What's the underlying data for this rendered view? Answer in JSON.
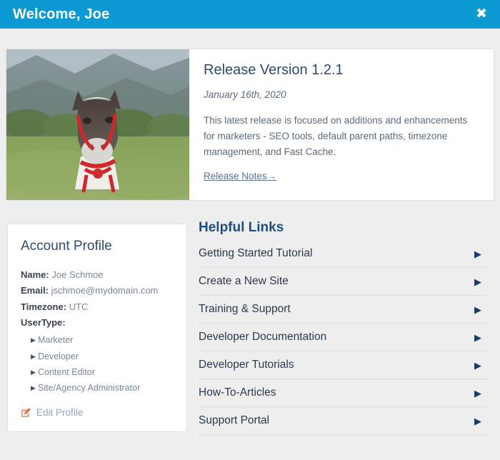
{
  "header": {
    "title": "Welcome, Joe",
    "close_label": "✖"
  },
  "release": {
    "title": "Release Version 1.2.1",
    "date": "January 16th, 2020",
    "description": "This latest release is focused on additions and enhancements for marketers - SEO tools, default parent paths, timezone management, and Fast Cache.",
    "link_label": "Release Notes→",
    "image_alt": "llama-photo"
  },
  "profile": {
    "title": "Account Profile",
    "name_label": "Name:",
    "name_value": "Joe Schmoe",
    "email_label": "Email:",
    "email_value": "jschmoe@mydomain.com",
    "timezone_label": "Timezone:",
    "timezone_value": "UTC",
    "usertype_label": "UserType:",
    "usertypes": [
      "Marketer",
      "Developer",
      "Content Editor",
      "Site/Agency Administrator"
    ],
    "edit_label": "Edit Profile"
  },
  "links": {
    "title": "Helpful Links",
    "arrow": "▶",
    "items": [
      {
        "label": "Getting Started Tutorial"
      },
      {
        "label": "Create a New Site"
      },
      {
        "label": "Training & Support"
      },
      {
        "label": "Developer Documentation"
      },
      {
        "label": "Developer Tutorials"
      },
      {
        "label": "How-To-Articles"
      },
      {
        "label": "Support Portal"
      }
    ]
  },
  "colors": {
    "header_blue": "#0d9ad3",
    "page_gray": "#eeeeee",
    "navy": "#1f4e87",
    "heading_blue": "#2e4a70",
    "body_gray": "#5c6b7a",
    "edit_orange": "#e0633a"
  }
}
